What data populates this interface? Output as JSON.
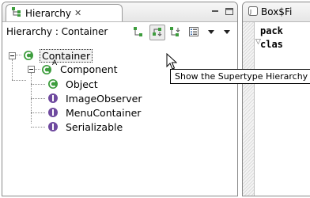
{
  "hierarchy_view": {
    "tab_title": "Hierarchy",
    "close_glyph": "✕",
    "scope_label": "Hierarchy : Container",
    "toolbar": {
      "tooltip": "Show the Supertype Hierarchy"
    },
    "tree": {
      "root": {
        "label": "Container",
        "icon": "class-icon"
      },
      "child": {
        "label": "Component",
        "icon": "abstract-class-icon",
        "badge": "A"
      },
      "leaves": [
        {
          "label": "Object",
          "icon": "class-icon"
        },
        {
          "label": "ImageObserver",
          "icon": "interface-icon"
        },
        {
          "label": "MenuContainer",
          "icon": "interface-icon"
        },
        {
          "label": "Serializable",
          "icon": "interface-icon"
        }
      ]
    }
  },
  "editor": {
    "tab_title": "Box$Fi",
    "code_lines": [
      "pack",
      "clas"
    ]
  },
  "colors": {
    "class_icon": "#3d9d3d",
    "interface_icon": "#6f4a9f",
    "selection_border": "#333333"
  }
}
